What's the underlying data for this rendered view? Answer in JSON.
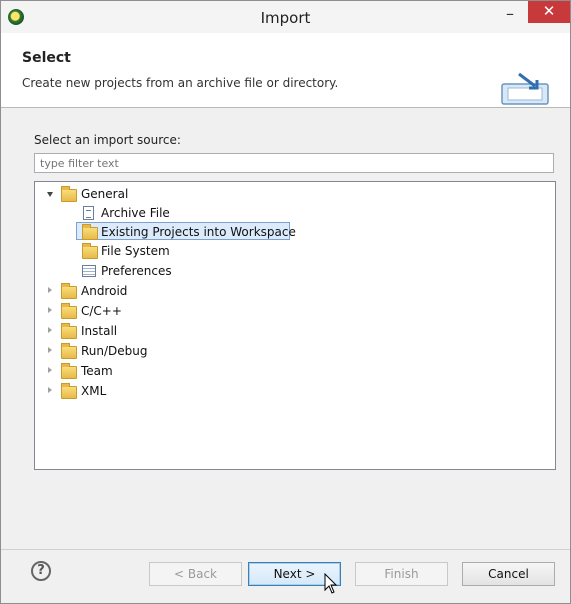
{
  "window": {
    "title": "Import"
  },
  "header": {
    "title": "Select",
    "description": "Create new projects from an archive file or directory."
  },
  "source": {
    "label": "Select an import source:",
    "filter_placeholder": "type filter text"
  },
  "tree": {
    "items": [
      {
        "label": "General",
        "icon": "folder-icon",
        "expanded": true
      },
      {
        "label": "Archive File",
        "icon": "archive-file-icon"
      },
      {
        "label": "Existing Projects into Workspace",
        "icon": "project-folder-icon",
        "selected": true
      },
      {
        "label": "File System",
        "icon": "folder-icon"
      },
      {
        "label": "Preferences",
        "icon": "preferences-icon"
      },
      {
        "label": "Android",
        "icon": "folder-icon",
        "expanded": false
      },
      {
        "label": "C/C++",
        "icon": "folder-icon",
        "expanded": false
      },
      {
        "label": "Install",
        "icon": "folder-icon",
        "expanded": false
      },
      {
        "label": "Run/Debug",
        "icon": "folder-icon",
        "expanded": false
      },
      {
        "label": "Team",
        "icon": "folder-icon",
        "expanded": false
      },
      {
        "label": "XML",
        "icon": "folder-icon",
        "expanded": false
      }
    ]
  },
  "buttons": {
    "back": "< Back",
    "next": "Next >",
    "finish": "Finish",
    "cancel": "Cancel",
    "help": "?"
  },
  "colors": {
    "close_button": "#c7393a",
    "selection": "#dcebfc",
    "primary_button_border": "#3c7fb1"
  }
}
